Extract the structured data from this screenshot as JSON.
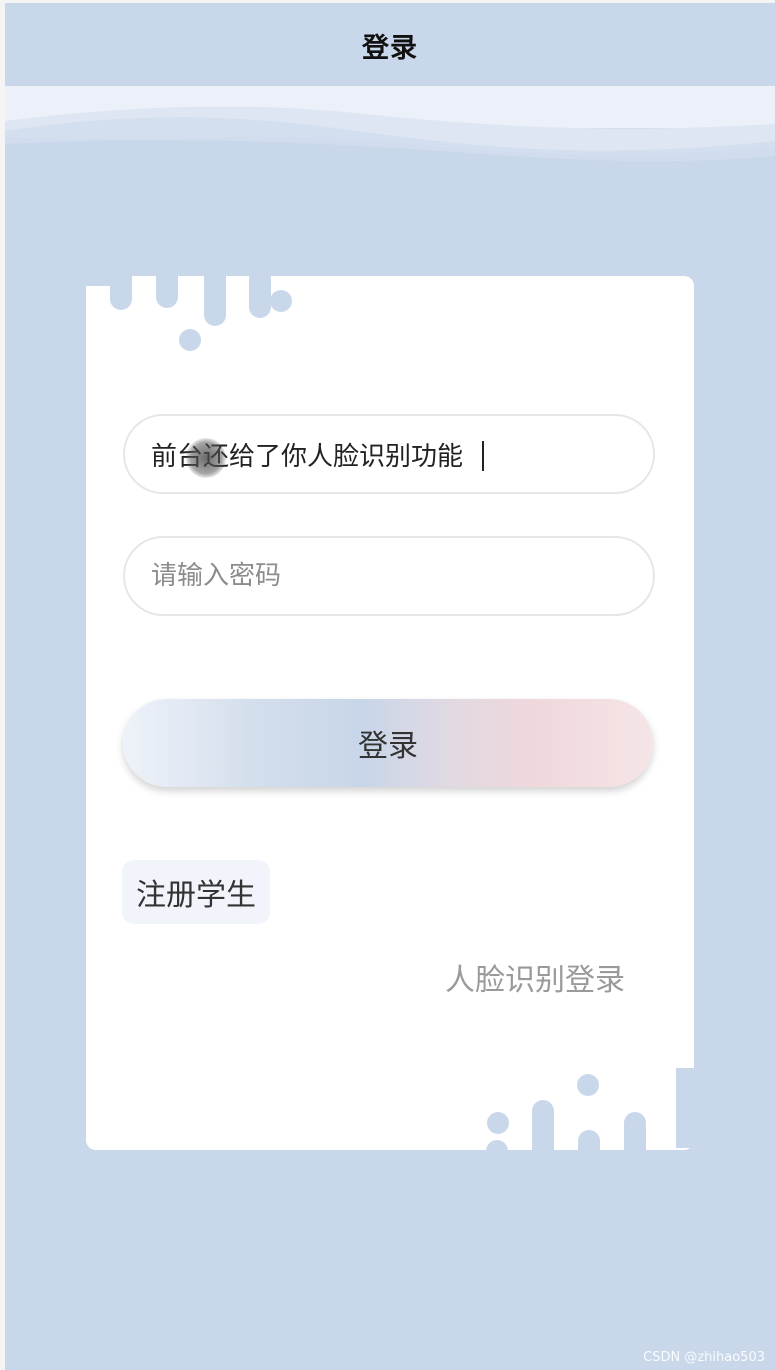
{
  "header": {
    "title": "登录"
  },
  "form": {
    "username_value": "前台还给了你人脸识别功能",
    "password_placeholder": "请输入密码",
    "login_label": "登录",
    "register_label": "注册学生",
    "face_login_label": "人脸识别登录"
  },
  "colors": {
    "background": "#c9d7ea",
    "card": "#ffffff"
  },
  "watermark": "CSDN @zhihao503"
}
